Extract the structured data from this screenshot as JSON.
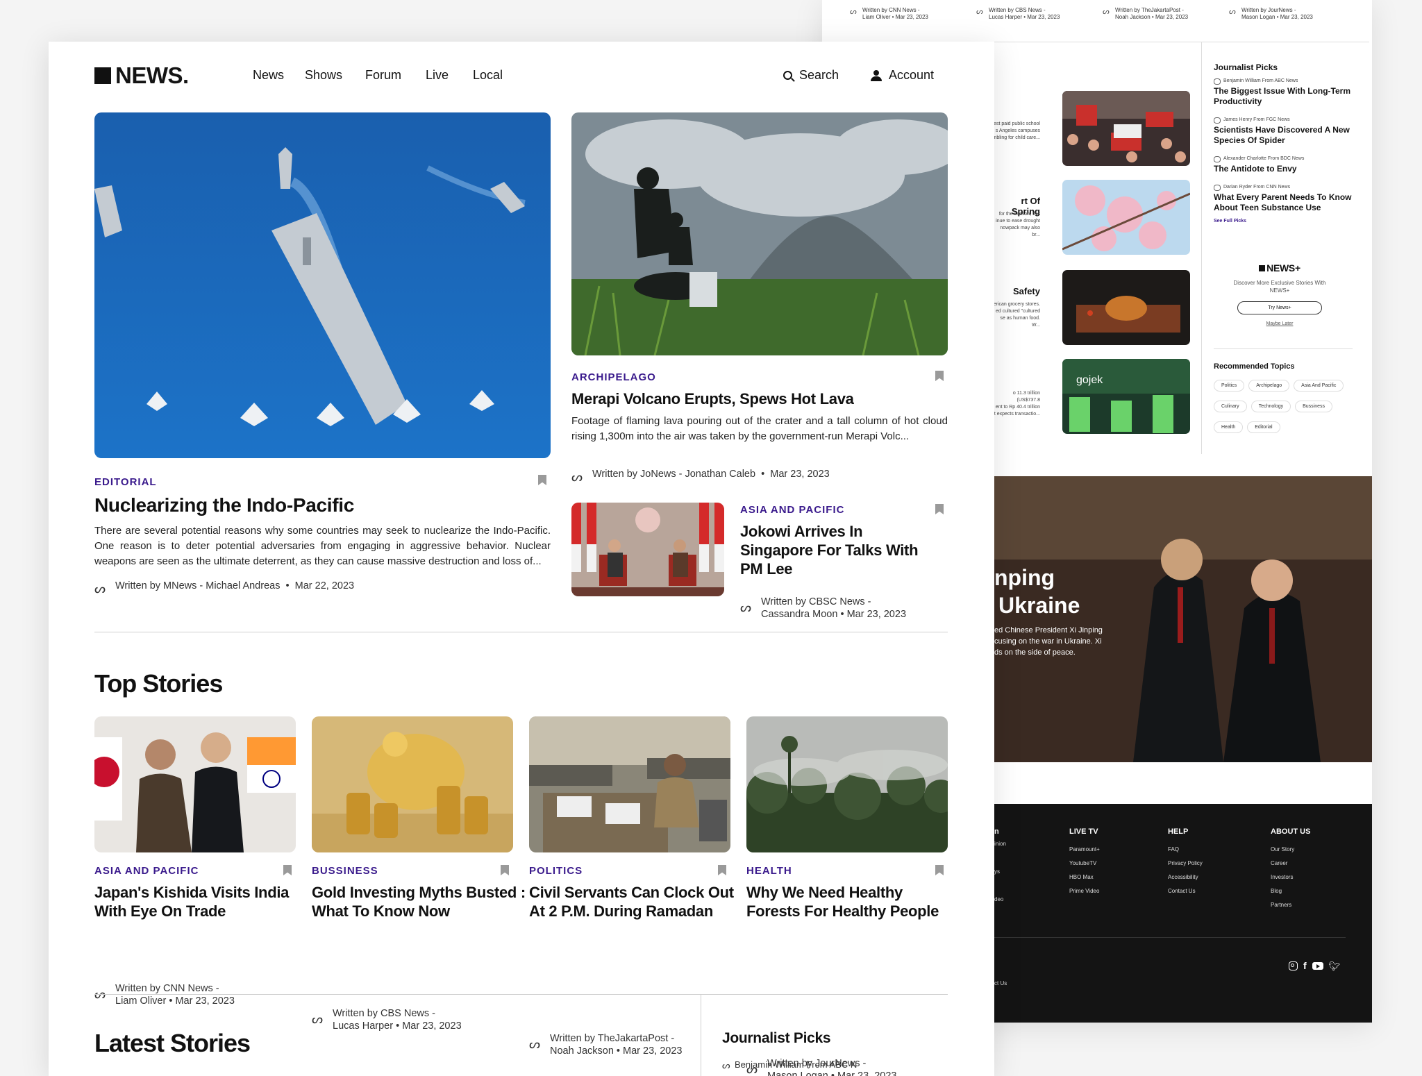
{
  "brand": {
    "logo": "NEWS."
  },
  "nav": {
    "items": [
      "News",
      "Shows",
      "Forum",
      "Live",
      "Local"
    ],
    "search": "Search",
    "account": "Account"
  },
  "hero": {
    "category": "EDITORIAL",
    "title": "Nuclearizing the Indo-Pacific",
    "excerpt": "There are several potential reasons why some countries may seek to nuclearize the Indo-Pacific. One reason is to deter potential adversaries from engaging in aggressive behavior. Nuclear weapons are seen as the ultimate deterrent, as they can cause massive destruction and loss of...",
    "byline": "Written by MNews - Michael Andreas",
    "date": "Mar 22, 2023"
  },
  "featured": {
    "category": "ARCHIPELAGO",
    "title": "Merapi Volcano Erupts, Spews Hot Lava",
    "excerpt": "Footage of flaming lava pouring out of the crater and a tall column of hot cloud rising 1,300m into the air was taken by the government-run Merapi Volc...",
    "byline": "Written by JoNews - Jonathan Caleb",
    "date": "Mar 23, 2023"
  },
  "secondary": {
    "category": "ASIA AND PACIFIC",
    "title": "Jokowi Arrives In Singapore For Talks With PM Lee",
    "byline1": "Written by CBSC News -",
    "byline2": "Cassandra Moon",
    "date": "Mar 23, 2023"
  },
  "top_stories": {
    "heading": "Top Stories",
    "items": [
      {
        "category": "ASIA AND PACIFIC",
        "title1": "Japan's Kishida Visits India",
        "title2": "With Eye On Trade",
        "by1": "Written by CNN News -",
        "by2": "Liam Oliver",
        "date": "Mar 23, 2023"
      },
      {
        "category": "BUSSINESS",
        "title1": "Gold Investing Myths Busted :",
        "title2": "What To Know Now",
        "by1": "Written by CBS News -",
        "by2": "Lucas Harper",
        "date": "Mar 23, 2023"
      },
      {
        "category": "POLITICS",
        "title1": "Civil Servants Can Clock Out",
        "title2": "At 2 P.M. During Ramadan",
        "by1": "Written by TheJakartaPost -",
        "by2": "Noah Jackson",
        "date": "Mar 23, 2023"
      },
      {
        "category": "HEALTH",
        "title1": "Why We Need Healthy",
        "title2": "Forests For Healthy People",
        "by1": "Written by JourNews -",
        "by2": "Mason Logan",
        "date": "Mar 23, 2023"
      }
    ]
  },
  "latest": {
    "heading": "Latest Stories"
  },
  "journalist_picks_front": {
    "heading": "Journalist Picks",
    "first": "Benjamin William From ABC N"
  },
  "back": {
    "top_bylines": [
      {
        "l1": "Written by CNN News -",
        "l2": "Liam Oliver",
        "date": "Mar 23, 2023"
      },
      {
        "l1": "Written by CBS News -",
        "l2": "Lucas Harper",
        "date": "Mar 23, 2023"
      },
      {
        "l1": "Written by TheJakartaPost -",
        "l2": "Noah Jackson",
        "date": "Mar 23, 2023"
      },
      {
        "l1": "Written by JourNews -",
        "l2": "Mason Logan",
        "date": "Mar 23, 2023"
      }
    ],
    "partial_stories": [
      {
        "title": "",
        "text": "est paid public school\ns Angeles campuses\nmbling for child care..."
      },
      {
        "title": "rt Of Spring",
        "text": "for the season, this\ninue to ease drought\nnowpack may also br..."
      },
      {
        "title": "Safety",
        "text": "erican grocery stores.\ned cultured \"cultured\nse as human food. W..."
      },
      {
        "title": "",
        "text": "o 11.3 trillion (US$737.8\nent to Rp 40.4 trillion\nit expects transactio..."
      }
    ],
    "picks": {
      "heading": "Journalist Picks",
      "items": [
        {
          "by": "Benjamin William From ABC News",
          "title": "The Biggest Issue With Long-Term Productivity"
        },
        {
          "by": "James Henry From FGC News",
          "title": "Scientists Have Discovered A New Species Of Spider"
        },
        {
          "by": "Alexander Charlotte From BDC News",
          "title": "The Antidote to Envy"
        },
        {
          "by": "Darian Ryder From CNN News",
          "title": "What Every Parent Needs To Know About Teen Substance Use"
        }
      ],
      "see_full": "See Full Picks"
    },
    "plus": {
      "logo": "NEWS+",
      "text": "Discover More Exclusive Stories With NEWS+",
      "button": "Try News+",
      "later": "Maybe Later"
    },
    "topics": {
      "heading": "Recommended Topics",
      "items": [
        "Politics",
        "Archipelago",
        "Asia And Pacific",
        "Culinary",
        "Technology",
        "Bussiness",
        "Health",
        "Editorial"
      ]
    },
    "banner": {
      "line1": "nping",
      "line2": "Ukraine",
      "text": "ed Chinese President Xi Jinping\ncusing on the war in Ukraine. Xi\nds on the side of peace."
    },
    "footer": {
      "partial_col": [
        "n",
        "inion",
        "ys",
        "deo"
      ],
      "partial_bottom": "ct Us",
      "cols": [
        {
          "h": "LIVE TV",
          "items": [
            "Paramount+",
            "YoutubeTV",
            "HBO Max",
            "Prime Video"
          ]
        },
        {
          "h": "HELP",
          "items": [
            "FAQ",
            "Privacy Policy",
            "Accessibility",
            "Contact Us"
          ]
        },
        {
          "h": "ABOUT US",
          "items": [
            "Our Story",
            "Career",
            "Investors",
            "Blog",
            "Partners"
          ]
        }
      ],
      "social": [
        "instagram-icon",
        "facebook-icon",
        "youtube-icon",
        "twitter-icon"
      ]
    }
  },
  "colors": {
    "accent": "#3a1a8c",
    "footer_bg": "#141414"
  }
}
